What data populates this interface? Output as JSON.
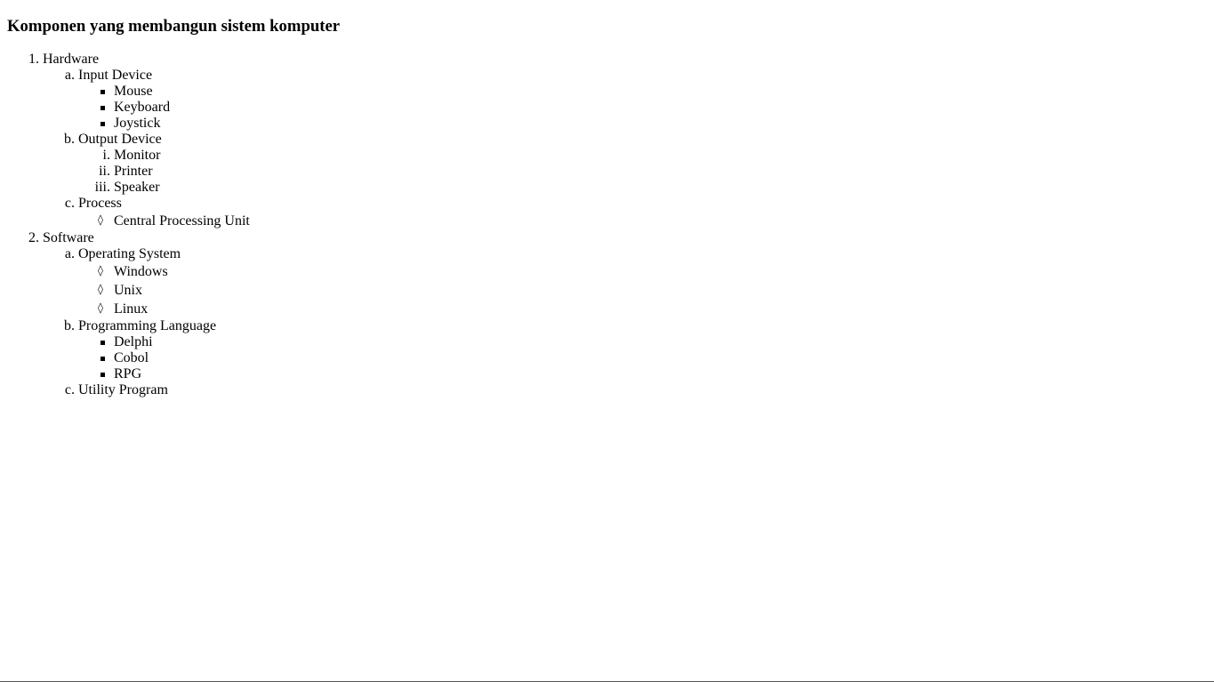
{
  "title": "Komponen yang membangun sistem komputer",
  "items": [
    {
      "marker": "1.",
      "label": "Hardware",
      "children": [
        {
          "marker": "a.",
          "label": "Input Device",
          "style": "square",
          "children": [
            {
              "label": "Mouse"
            },
            {
              "label": "Keyboard"
            },
            {
              "label": "Joystick"
            }
          ]
        },
        {
          "marker": "b.",
          "label": "Output Device",
          "style": "roman",
          "children": [
            {
              "marker": "i.",
              "label": "Monitor"
            },
            {
              "marker": "ii.",
              "label": "Printer"
            },
            {
              "marker": "iii.",
              "label": "Speaker"
            }
          ]
        },
        {
          "marker": "c.",
          "label": "Process",
          "style": "diamond",
          "children": [
            {
              "marker": "◊",
              "label": "Central Processing Unit"
            }
          ]
        }
      ]
    },
    {
      "marker": "2.",
      "label": "Software",
      "children": [
        {
          "marker": "a.",
          "label": "Operating System",
          "style": "diamond",
          "children": [
            {
              "marker": "◊",
              "label": "Windows"
            },
            {
              "marker": "◊",
              "label": "Unix"
            },
            {
              "marker": "◊",
              "label": "Linux"
            }
          ]
        },
        {
          "marker": "b.",
          "label": "Programming Language",
          "style": "square",
          "children": [
            {
              "label": "Delphi"
            },
            {
              "label": "Cobol"
            },
            {
              "label": "RPG"
            }
          ]
        },
        {
          "marker": "c.",
          "label": "Utility Program",
          "children": []
        }
      ]
    }
  ]
}
